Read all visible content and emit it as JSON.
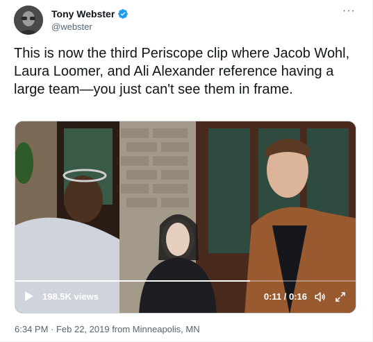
{
  "author": {
    "name": "Tony Webster",
    "handle": "@webster",
    "verified": true
  },
  "tweet": {
    "text": "This is now the third Periscope clip where Jacob Wohl, Laura Loomer, and Ali Alexander reference having a large team—you just can't see them in frame."
  },
  "video": {
    "views": "198.5K views",
    "time": "0:11 / 0:16",
    "progress": 0.69
  },
  "meta": {
    "timestamp": "6:34 PM · Feb 22, 2019 from Minneapolis, MN"
  },
  "icons": {
    "more": "more-options-icon",
    "verified": "verified-badge-icon",
    "play": "play-icon",
    "volume": "volume-icon",
    "fullscreen": "fullscreen-icon"
  },
  "colors": {
    "verified": "#1d9bf0",
    "text": "#0f1419",
    "secondary": "#536471"
  }
}
